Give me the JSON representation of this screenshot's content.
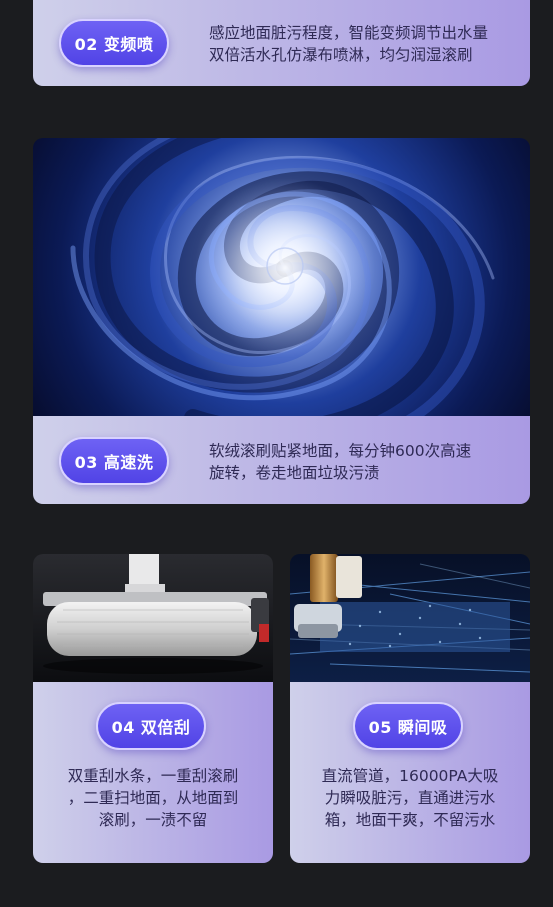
{
  "features": [
    {
      "badge": "02 变频喷",
      "lines": [
        "感应地面脏污程度，智能变频调节出水量",
        "双倍活水孔仿瀑布喷淋，均匀润湿滚刷"
      ]
    },
    {
      "badge": "03 高速洗",
      "lines": [
        "软绒滚刷贴紧地面，每分钟600次高速",
        "旋转，卷走地面垃圾污渍"
      ]
    },
    {
      "badge": "04 双倍刮",
      "lines": [
        "双重刮水条，一重刮滚刷",
        "，二重扫地面，从地面到",
        "滚刷，一渍不留"
      ]
    },
    {
      "badge": "05 瞬间吸",
      "lines": [
        "直流管道，16000PA大吸",
        "力瞬吸脏污，直通进污水",
        "箱，地面干爽，不留污水"
      ]
    }
  ],
  "colors": {
    "background": "#1b1c1f",
    "badge": "#5a4cf0",
    "card_end": "#a99ae3"
  }
}
